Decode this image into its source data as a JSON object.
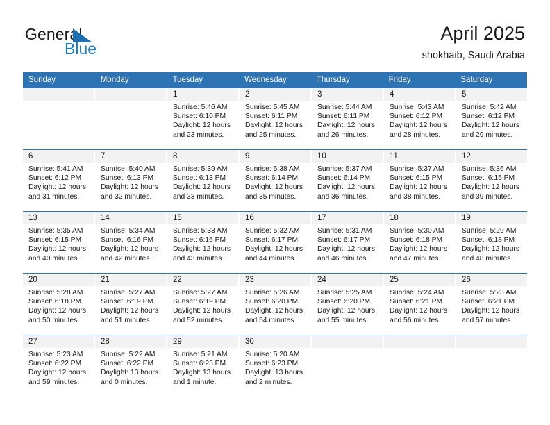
{
  "brand": {
    "name_part1": "General",
    "name_part2": "Blue",
    "triangle_color": "#1f6fb5",
    "blue_color": "#1f7ac4"
  },
  "header": {
    "title": "April 2025",
    "subtitle": "shokhaib, Saudi Arabia"
  },
  "theme": {
    "header_blue": "#2e74b5",
    "daynum_band": "#f2f2f2"
  },
  "weekdays": [
    "Sunday",
    "Monday",
    "Tuesday",
    "Wednesday",
    "Thursday",
    "Friday",
    "Saturday"
  ],
  "weeks": [
    [
      {
        "day": "",
        "sunrise": "",
        "sunset": "",
        "daylight": "",
        "empty": true
      },
      {
        "day": "",
        "sunrise": "",
        "sunset": "",
        "daylight": "",
        "empty": true
      },
      {
        "day": "1",
        "sunrise": "Sunrise: 5:46 AM",
        "sunset": "Sunset: 6:10 PM",
        "daylight": "Daylight: 12 hours and 23 minutes."
      },
      {
        "day": "2",
        "sunrise": "Sunrise: 5:45 AM",
        "sunset": "Sunset: 6:11 PM",
        "daylight": "Daylight: 12 hours and 25 minutes."
      },
      {
        "day": "3",
        "sunrise": "Sunrise: 5:44 AM",
        "sunset": "Sunset: 6:11 PM",
        "daylight": "Daylight: 12 hours and 26 minutes."
      },
      {
        "day": "4",
        "sunrise": "Sunrise: 5:43 AM",
        "sunset": "Sunset: 6:12 PM",
        "daylight": "Daylight: 12 hours and 28 minutes."
      },
      {
        "day": "5",
        "sunrise": "Sunrise: 5:42 AM",
        "sunset": "Sunset: 6:12 PM",
        "daylight": "Daylight: 12 hours and 29 minutes."
      }
    ],
    [
      {
        "day": "6",
        "sunrise": "Sunrise: 5:41 AM",
        "sunset": "Sunset: 6:12 PM",
        "daylight": "Daylight: 12 hours and 31 minutes."
      },
      {
        "day": "7",
        "sunrise": "Sunrise: 5:40 AM",
        "sunset": "Sunset: 6:13 PM",
        "daylight": "Daylight: 12 hours and 32 minutes."
      },
      {
        "day": "8",
        "sunrise": "Sunrise: 5:39 AM",
        "sunset": "Sunset: 6:13 PM",
        "daylight": "Daylight: 12 hours and 33 minutes."
      },
      {
        "day": "9",
        "sunrise": "Sunrise: 5:38 AM",
        "sunset": "Sunset: 6:14 PM",
        "daylight": "Daylight: 12 hours and 35 minutes."
      },
      {
        "day": "10",
        "sunrise": "Sunrise: 5:37 AM",
        "sunset": "Sunset: 6:14 PM",
        "daylight": "Daylight: 12 hours and 36 minutes."
      },
      {
        "day": "11",
        "sunrise": "Sunrise: 5:37 AM",
        "sunset": "Sunset: 6:15 PM",
        "daylight": "Daylight: 12 hours and 38 minutes."
      },
      {
        "day": "12",
        "sunrise": "Sunrise: 5:36 AM",
        "sunset": "Sunset: 6:15 PM",
        "daylight": "Daylight: 12 hours and 39 minutes."
      }
    ],
    [
      {
        "day": "13",
        "sunrise": "Sunrise: 5:35 AM",
        "sunset": "Sunset: 6:15 PM",
        "daylight": "Daylight: 12 hours and 40 minutes."
      },
      {
        "day": "14",
        "sunrise": "Sunrise: 5:34 AM",
        "sunset": "Sunset: 6:16 PM",
        "daylight": "Daylight: 12 hours and 42 minutes."
      },
      {
        "day": "15",
        "sunrise": "Sunrise: 5:33 AM",
        "sunset": "Sunset: 6:16 PM",
        "daylight": "Daylight: 12 hours and 43 minutes."
      },
      {
        "day": "16",
        "sunrise": "Sunrise: 5:32 AM",
        "sunset": "Sunset: 6:17 PM",
        "daylight": "Daylight: 12 hours and 44 minutes."
      },
      {
        "day": "17",
        "sunrise": "Sunrise: 5:31 AM",
        "sunset": "Sunset: 6:17 PM",
        "daylight": "Daylight: 12 hours and 46 minutes."
      },
      {
        "day": "18",
        "sunrise": "Sunrise: 5:30 AM",
        "sunset": "Sunset: 6:18 PM",
        "daylight": "Daylight: 12 hours and 47 minutes."
      },
      {
        "day": "19",
        "sunrise": "Sunrise: 5:29 AM",
        "sunset": "Sunset: 6:18 PM",
        "daylight": "Daylight: 12 hours and 48 minutes."
      }
    ],
    [
      {
        "day": "20",
        "sunrise": "Sunrise: 5:28 AM",
        "sunset": "Sunset: 6:18 PM",
        "daylight": "Daylight: 12 hours and 50 minutes."
      },
      {
        "day": "21",
        "sunrise": "Sunrise: 5:27 AM",
        "sunset": "Sunset: 6:19 PM",
        "daylight": "Daylight: 12 hours and 51 minutes."
      },
      {
        "day": "22",
        "sunrise": "Sunrise: 5:27 AM",
        "sunset": "Sunset: 6:19 PM",
        "daylight": "Daylight: 12 hours and 52 minutes."
      },
      {
        "day": "23",
        "sunrise": "Sunrise: 5:26 AM",
        "sunset": "Sunset: 6:20 PM",
        "daylight": "Daylight: 12 hours and 54 minutes."
      },
      {
        "day": "24",
        "sunrise": "Sunrise: 5:25 AM",
        "sunset": "Sunset: 6:20 PM",
        "daylight": "Daylight: 12 hours and 55 minutes."
      },
      {
        "day": "25",
        "sunrise": "Sunrise: 5:24 AM",
        "sunset": "Sunset: 6:21 PM",
        "daylight": "Daylight: 12 hours and 56 minutes."
      },
      {
        "day": "26",
        "sunrise": "Sunrise: 5:23 AM",
        "sunset": "Sunset: 6:21 PM",
        "daylight": "Daylight: 12 hours and 57 minutes."
      }
    ],
    [
      {
        "day": "27",
        "sunrise": "Sunrise: 5:23 AM",
        "sunset": "Sunset: 6:22 PM",
        "daylight": "Daylight: 12 hours and 59 minutes."
      },
      {
        "day": "28",
        "sunrise": "Sunrise: 5:22 AM",
        "sunset": "Sunset: 6:22 PM",
        "daylight": "Daylight: 13 hours and 0 minutes."
      },
      {
        "day": "29",
        "sunrise": "Sunrise: 5:21 AM",
        "sunset": "Sunset: 6:23 PM",
        "daylight": "Daylight: 13 hours and 1 minute."
      },
      {
        "day": "30",
        "sunrise": "Sunrise: 5:20 AM",
        "sunset": "Sunset: 6:23 PM",
        "daylight": "Daylight: 13 hours and 2 minutes."
      },
      {
        "day": "",
        "sunrise": "",
        "sunset": "",
        "daylight": "",
        "empty": true
      },
      {
        "day": "",
        "sunrise": "",
        "sunset": "",
        "daylight": "",
        "empty": true
      },
      {
        "day": "",
        "sunrise": "",
        "sunset": "",
        "daylight": "",
        "empty": true
      }
    ]
  ]
}
